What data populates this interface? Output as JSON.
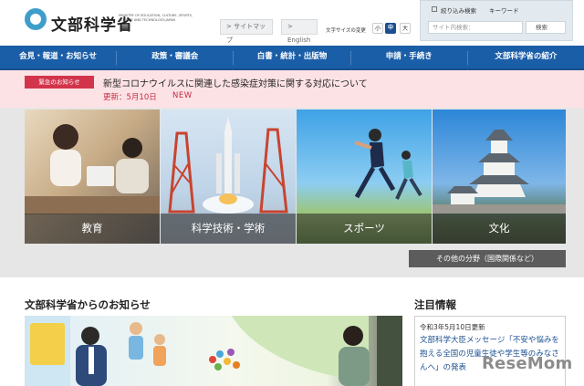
{
  "header": {
    "logo_jp": "文部科学省",
    "logo_en": "MINISTRY OF EDUCATION, CULTURE, SPORTS, SCIENCE AND TECHNOLOGY-JAPAN",
    "sitemap_label": "> サイトマップ",
    "english_label": "> English",
    "font_size_label": "文字サイズの変更",
    "font_size_small": "小",
    "font_size_medium": "中",
    "font_size_large": "大",
    "search": {
      "filter_tab": "絞り込み検索",
      "keyword_tab": "キーワード",
      "placeholder": "サイト内検索：",
      "button_label": "検索"
    }
  },
  "nav": {
    "items": [
      "会見・報道・お知らせ",
      "政策・審議会",
      "白書・統計・出版物",
      "申請・手続き",
      "文部科学省の紹介"
    ]
  },
  "alert": {
    "badge": "緊急のお知らせ",
    "title": "新型コロナウイルスに関連した感染症対策に関する対応について",
    "updated": "更新：5月10日",
    "new_badge": "NEW"
  },
  "hero": {
    "tiles": [
      "教育",
      "科学技術・学術",
      "スポーツ",
      "文化"
    ],
    "more_label": "その他の分野（国際関係など）"
  },
  "news": {
    "heading": "文部科学省からのお知らせ"
  },
  "featured": {
    "heading": "注目情報",
    "date": "令和3年5月10日更新",
    "text": "文部科学大臣メッセージ「不安や悩みを抱える全国の児童生徒や学生等のみなさんへ」の発表"
  },
  "watermark": "ReseMom",
  "colors": {
    "nav": "#1b5ea8",
    "alert_bg": "#fde2e5",
    "alert_badge": "#d2344b",
    "alert_text": "#c22a43",
    "font_size_active": "#1b4f91"
  }
}
